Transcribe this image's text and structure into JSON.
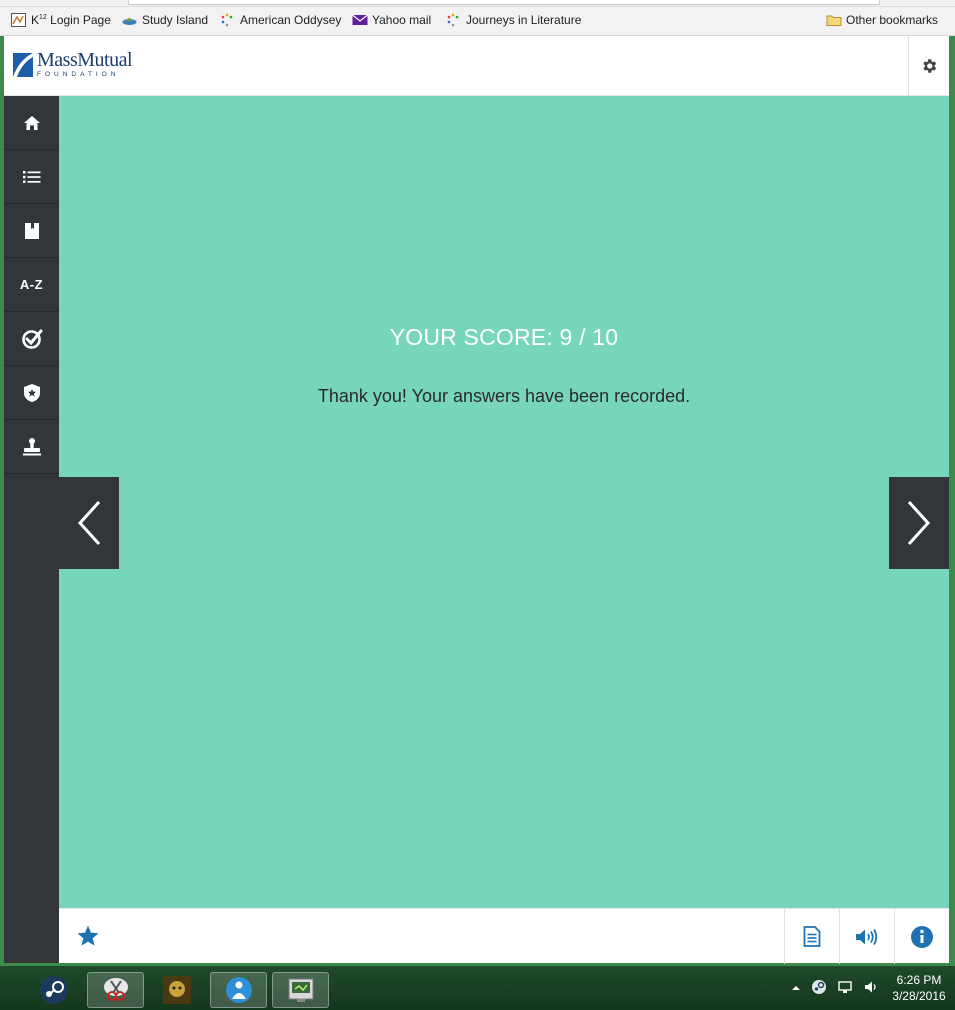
{
  "bookmarks_bar": {
    "items": [
      {
        "label": "Login Page",
        "prefix": "K",
        "sup": "12"
      },
      {
        "label": "Study Island"
      },
      {
        "label": "American Oddysey"
      },
      {
        "label": "Yahoo mail"
      },
      {
        "label": "Journeys in Literature"
      }
    ],
    "other": "Other bookmarks"
  },
  "header": {
    "brand_name": "MassMutual",
    "brand_sub": "FOUNDATION"
  },
  "sidebar": {
    "items": [
      {
        "icon": "home-icon"
      },
      {
        "icon": "list-icon"
      },
      {
        "icon": "book-icon"
      },
      {
        "icon": "glossary-icon",
        "label": "A-Z"
      },
      {
        "icon": "check-circle-icon"
      },
      {
        "icon": "shield-star-icon"
      },
      {
        "icon": "stamp-icon"
      }
    ]
  },
  "main": {
    "score_text": "YOUR SCORE: 9 / 10",
    "message": "Thank you! Your answers have been recorded."
  },
  "colors": {
    "content_bg": "#76d5bb",
    "sidebar_bg": "#333639",
    "accent_blue": "#1e73b0"
  },
  "taskbar": {
    "time": "6:26 PM",
    "date": "3/28/2016"
  }
}
